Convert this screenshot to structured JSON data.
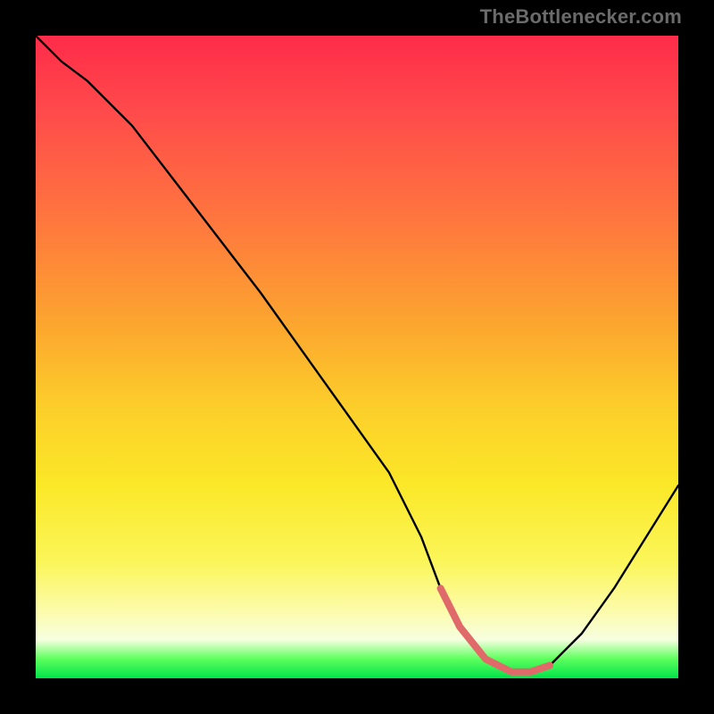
{
  "watermark": "TheBottlenecker.com",
  "chart_data": {
    "type": "line",
    "title": "",
    "xlabel": "",
    "ylabel": "",
    "xlim": [
      0,
      100
    ],
    "ylim": [
      0,
      100
    ],
    "series": [
      {
        "name": "curve",
        "x": [
          0,
          4,
          8,
          15,
          25,
          35,
          45,
          55,
          60,
          63,
          66,
          70,
          74,
          77,
          80,
          85,
          90,
          95,
          100
        ],
        "y": [
          100,
          96,
          93,
          86,
          73,
          60,
          46,
          32,
          22,
          14,
          8,
          3,
          1,
          1,
          2,
          7,
          14,
          22,
          30
        ]
      },
      {
        "name": "highlight",
        "x": [
          63,
          66,
          70,
          74,
          77,
          80
        ],
        "y": [
          14,
          8,
          3,
          1,
          1,
          2
        ]
      }
    ],
    "annotations": []
  },
  "colors": {
    "curve": "#000000",
    "highlight": "#e06a6a",
    "background_top": "#ff2b4a",
    "background_bottom": "#00e34a",
    "frame": "#000000"
  }
}
